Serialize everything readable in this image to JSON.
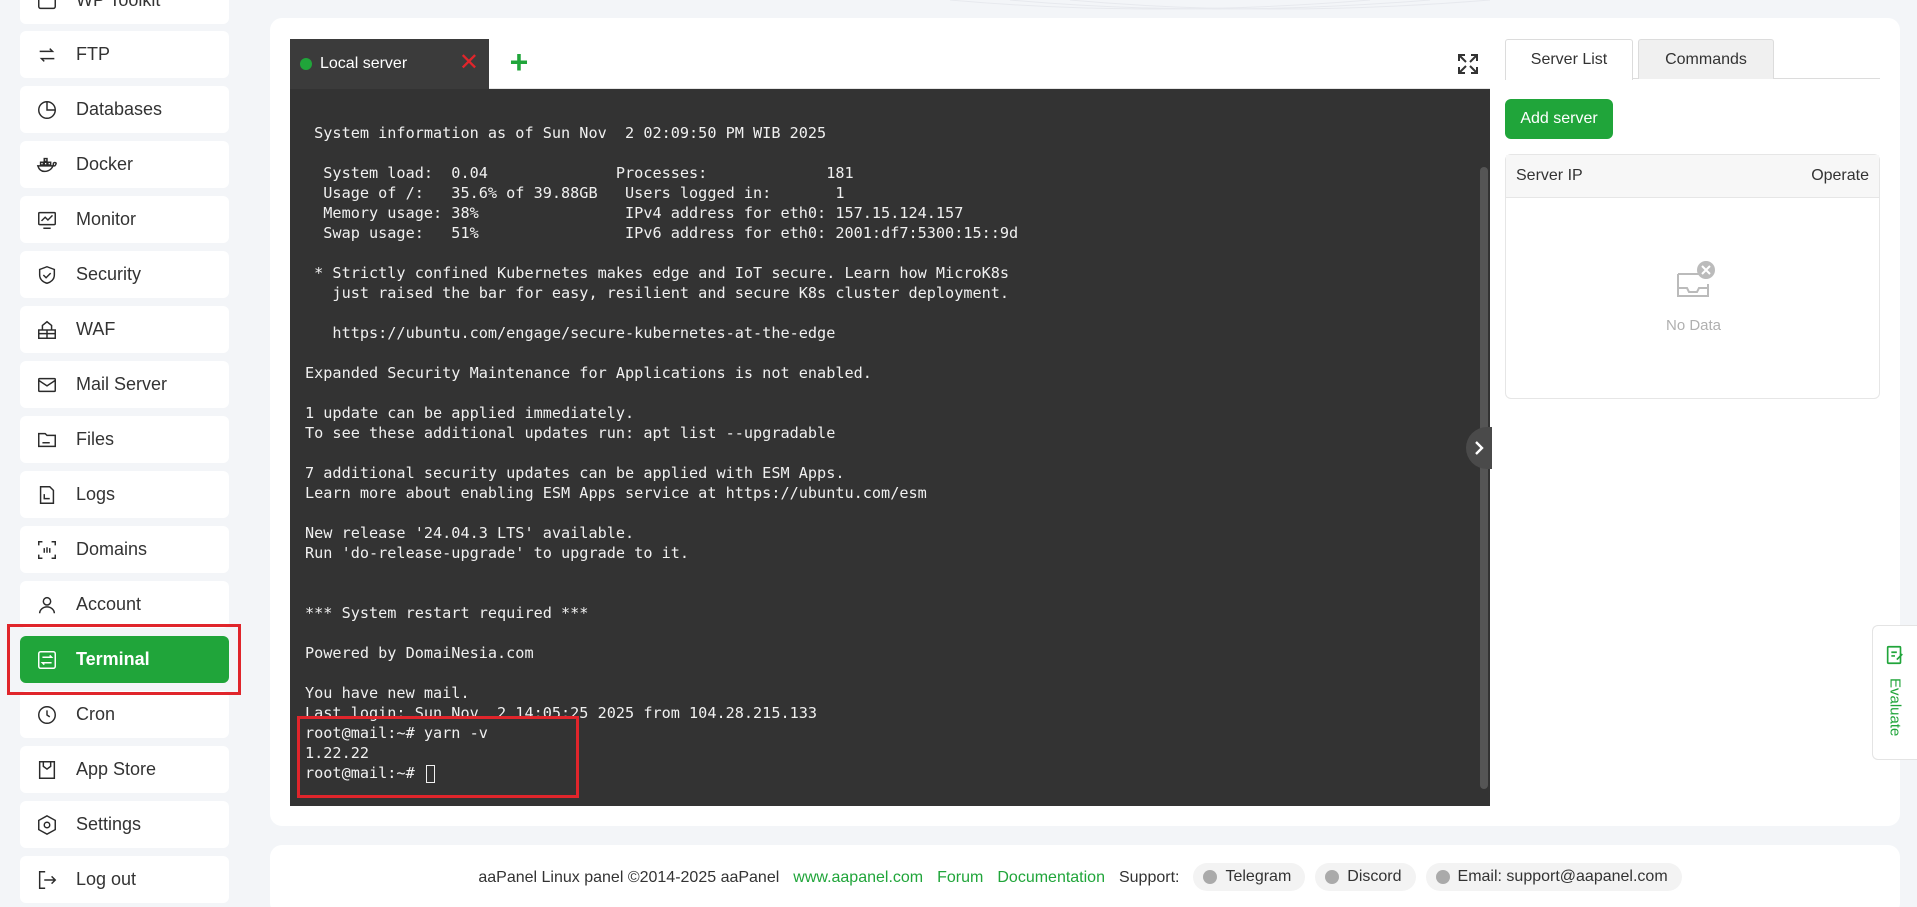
{
  "sidebar": {
    "items": [
      {
        "label": "WP Toolkit",
        "icon": "wp-toolkit-icon"
      },
      {
        "label": "FTP",
        "icon": "ftp-icon"
      },
      {
        "label": "Databases",
        "icon": "databases-icon"
      },
      {
        "label": "Docker",
        "icon": "docker-icon"
      },
      {
        "label": "Monitor",
        "icon": "monitor-icon"
      },
      {
        "label": "Security",
        "icon": "security-icon"
      },
      {
        "label": "WAF",
        "icon": "waf-icon"
      },
      {
        "label": "Mail Server",
        "icon": "mail-server-icon"
      },
      {
        "label": "Files",
        "icon": "files-icon"
      },
      {
        "label": "Logs",
        "icon": "logs-icon"
      },
      {
        "label": "Domains",
        "icon": "domains-icon"
      },
      {
        "label": "Account",
        "icon": "account-icon"
      },
      {
        "label": "Terminal",
        "icon": "terminal-icon"
      },
      {
        "label": "Cron",
        "icon": "cron-icon"
      },
      {
        "label": "App Store",
        "icon": "app-store-icon"
      },
      {
        "label": "Settings",
        "icon": "settings-icon"
      },
      {
        "label": "Log out",
        "icon": "logout-icon"
      }
    ],
    "active": "Terminal"
  },
  "terminal": {
    "tab_label": "Local server",
    "close_symbol": "✕",
    "add_symbol": "+",
    "lines": [
      " System information as of Sun Nov  2 02:09:50 PM WIB 2025",
      "",
      "  System load:  0.04              Processes:             181",
      "  Usage of /:   35.6% of 39.88GB   Users logged in:       1",
      "  Memory usage: 38%                IPv4 address for eth0: 157.15.124.157",
      "  Swap usage:   51%                IPv6 address for eth0: 2001:df7:5300:15::9d",
      "",
      " * Strictly confined Kubernetes makes edge and IoT secure. Learn how MicroK8s",
      "   just raised the bar for easy, resilient and secure K8s cluster deployment.",
      "",
      "   https://ubuntu.com/engage/secure-kubernetes-at-the-edge",
      "",
      "Expanded Security Maintenance for Applications is not enabled.",
      "",
      "1 update can be applied immediately.",
      "To see these additional updates run: apt list --upgradable",
      "",
      "7 additional security updates can be applied with ESM Apps.",
      "Learn more about enabling ESM Apps service at https://ubuntu.com/esm",
      "",
      "New release '24.04.3 LTS' available.",
      "Run 'do-release-upgrade' to upgrade to it.",
      "",
      "",
      "*** System restart required ***",
      "",
      "Powered by DomaiNesia.com",
      "",
      "You have new mail.",
      "Last login: Sun Nov  2 14:05:25 2025 from 104.28.215.133",
      "root@mail:~# yarn -v",
      "1.22.22",
      "root@mail:~# "
    ]
  },
  "right_panel": {
    "tabs": [
      "Server List",
      "Commands"
    ],
    "add_button": "Add server",
    "columns": [
      "Server IP",
      "Operate"
    ],
    "empty_text": "No Data"
  },
  "evaluate": {
    "label": "Evaluate"
  },
  "footer": {
    "copyright": "aaPanel Linux panel ©2014-2025 aaPanel",
    "links": [
      "www.aapanel.com",
      "Forum",
      "Documentation"
    ],
    "support_label": "Support:",
    "pills": [
      "Telegram",
      "Discord",
      "Email: support@aapanel.com"
    ]
  },
  "colors": {
    "accent": "#20a53a",
    "highlight": "#e0252b",
    "terminal_bg": "#333333"
  }
}
